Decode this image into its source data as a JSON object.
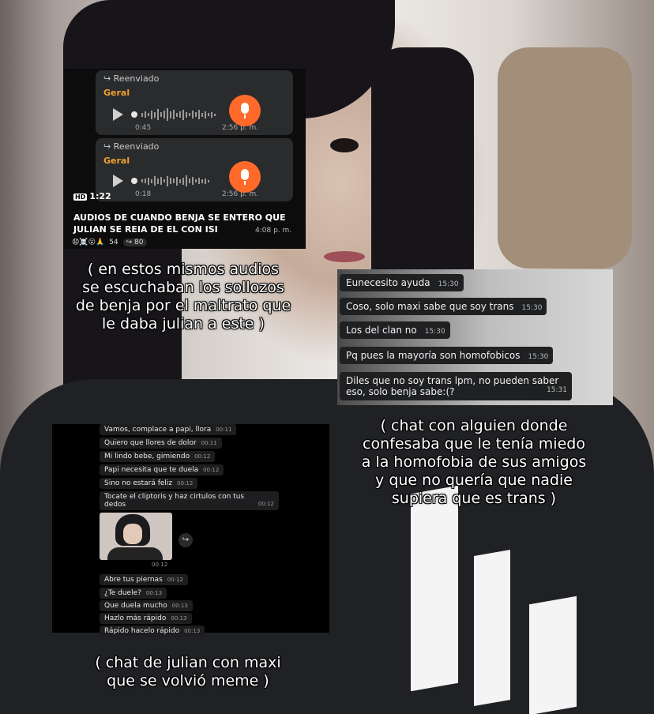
{
  "voice_card": {
    "messages": [
      {
        "forwarded": "Reenviado",
        "sender": "Geral",
        "duration": "0:45",
        "time": "2:56 p. m."
      },
      {
        "forwarded": "Reenviado",
        "sender": "Geral",
        "duration": "0:18",
        "time": "2:56 p. m."
      }
    ],
    "hd_badge": "HD",
    "video_length": "1:22",
    "title_line1": "AUDIOS DE CUANDO BENJA SE ENTERO QUE",
    "title_line2": "JULIAN SE REIA DE EL CON ISI",
    "post_time": "4:08 p. m.",
    "reactions": "😧☠️😮🙏",
    "reaction_count": "54",
    "forward_count": "80"
  },
  "caption_1": {
    "lines": [
      "( en estos mismos audios",
      "se escuchaban los sollozos",
      "de benja por el maltrato que",
      "le daba julian a este )"
    ]
  },
  "chat_card": {
    "messages": [
      {
        "text": "Eunecesito ayuda",
        "time": "15:30"
      },
      {
        "text": "Coso, solo maxi sabe que soy trans",
        "time": "15:30"
      },
      {
        "text": "Los del clan no",
        "time": "15:30"
      },
      {
        "text": "Pq pues la mayoría son homofobicos",
        "time": "15:30"
      },
      {
        "text_line1": "Diles que no soy trans lpm, no pueden saber",
        "text_line2": "eso, solo benja sabe:(?",
        "time": "15:31"
      }
    ]
  },
  "caption_2": {
    "lines": [
      "( chat con alguien donde",
      "confesaba que le tenía miedo",
      "a la homofobia de sus amigos",
      "y que no quería que nadie",
      "supiera que es trans )"
    ]
  },
  "dark_chat": {
    "messages": [
      {
        "text": "Vamos, complace a papi, llora",
        "time": "00:11"
      },
      {
        "text": "Quiero que llores de dolor",
        "time": "00:11"
      },
      {
        "text": "Mi lindo bebe, gimiendo",
        "time": "00:12"
      },
      {
        "text": "Papi necesita que te duela",
        "time": "00:12"
      },
      {
        "text": "Sino no estará feliz",
        "time": "00:12"
      },
      {
        "text_line1": "Tocate el cliptoris y haz cirtulos con tus",
        "text_line2": "dedos",
        "time": "00:12"
      }
    ],
    "image_time": "00:12",
    "messages_after": [
      {
        "text": "Abre tus piernas",
        "time": "00:12"
      },
      {
        "text": "¿Te duele?",
        "time": "00:13"
      },
      {
        "text": "Que duela mucho",
        "time": "00:13"
      },
      {
        "text": "Hazlo más rápido",
        "time": "00:13"
      },
      {
        "text": "Rápido hacelo rápido",
        "time": "00:13"
      }
    ]
  },
  "caption_3": {
    "lines": [
      "( chat de julian con maxi",
      "que se volvió meme )"
    ]
  }
}
